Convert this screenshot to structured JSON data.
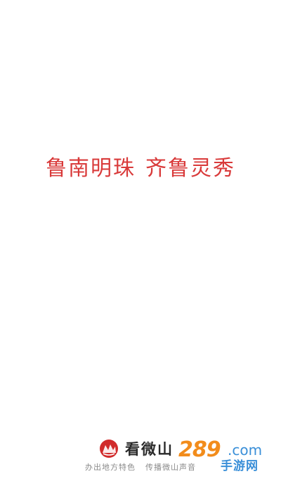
{
  "splash": {
    "slogan_part1": "鲁南明珠",
    "slogan_part2": "齐鲁灵秀",
    "app_name": "看微山",
    "tagline_part1": "办出地方特色",
    "tagline_part2": "传播微山声音",
    "logo_icon": "lotus-mountain-logo"
  },
  "watermark": {
    "number": "289",
    "domain": ".com",
    "site_name": "手游网"
  },
  "colors": {
    "slogan": "#d93a3a",
    "logo_red": "#d12b2b",
    "watermark_orange": "#f28c1b",
    "watermark_blue": "#3a8fd8"
  }
}
